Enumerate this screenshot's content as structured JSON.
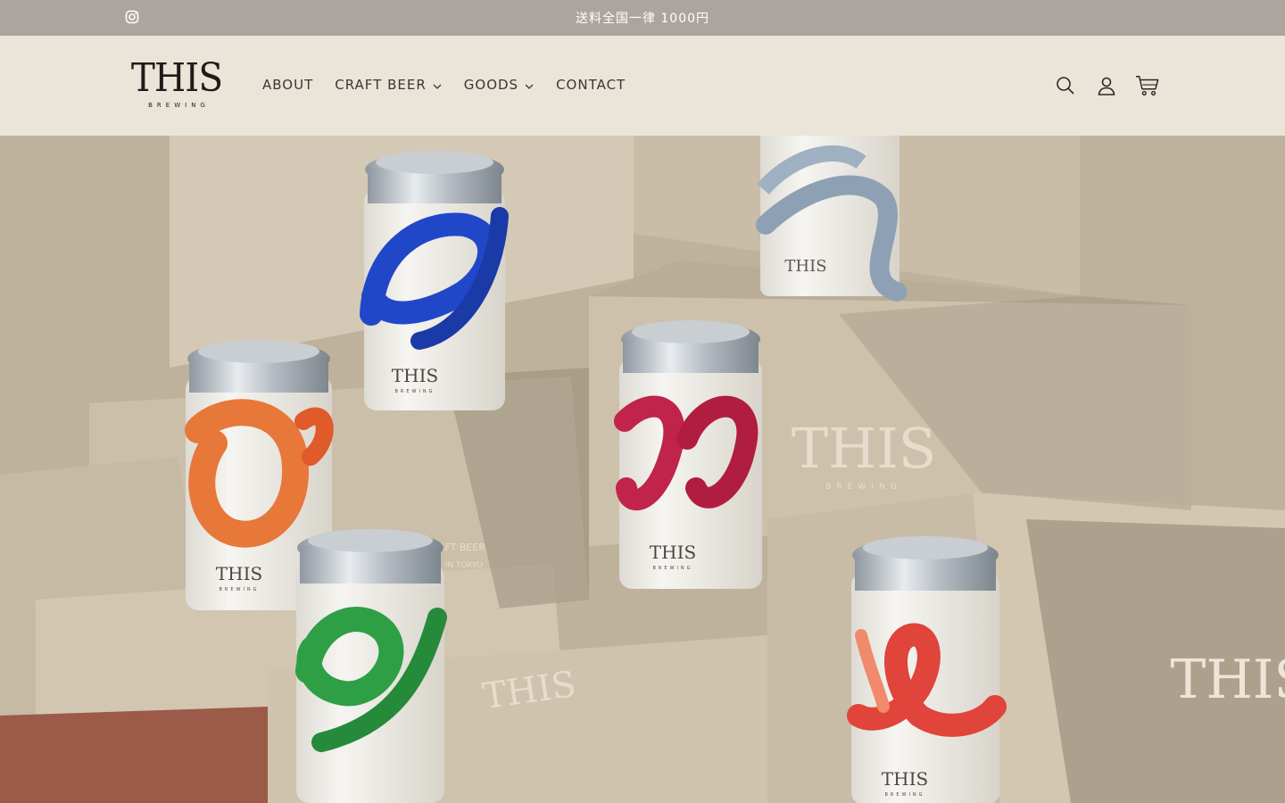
{
  "announcement": {
    "text": "送料全国一律 1000円",
    "social_icon": "instagram-icon"
  },
  "brand": {
    "logo_text": "THIS",
    "logo_sub": "BREWING"
  },
  "nav": {
    "items": [
      {
        "label": "ABOUT",
        "has_dropdown": false
      },
      {
        "label": "CRAFT BEER",
        "has_dropdown": true
      },
      {
        "label": "GOODS",
        "has_dropdown": true
      },
      {
        "label": "CONTACT",
        "has_dropdown": false
      }
    ]
  },
  "header_icons": [
    "search-icon",
    "account-icon",
    "cart-icon"
  ],
  "hero": {
    "can_label": "THIS",
    "can_sub": "BREWING",
    "box_text_1": "THIS",
    "box_text_1_sub": "BREWING",
    "box_text_2": "CRAFT BEER",
    "box_text_3": "IN TOKYO",
    "box_text_4": "THIS",
    "colors": {
      "background": "#c4b8a4",
      "box": "#cfc3ae",
      "box_shadow": "#8e826f",
      "can_body": "#f3f1ec",
      "blue": "#2147c9",
      "orange": "#e8773a",
      "green": "#2e9f45",
      "crimson": "#c0244a",
      "steel": "#8ea0b4",
      "red": "#e0443a"
    }
  },
  "colors": {
    "announcement_bg": "#aca49f",
    "header_bg": "#ebe4d9",
    "text": "#3a3733"
  }
}
